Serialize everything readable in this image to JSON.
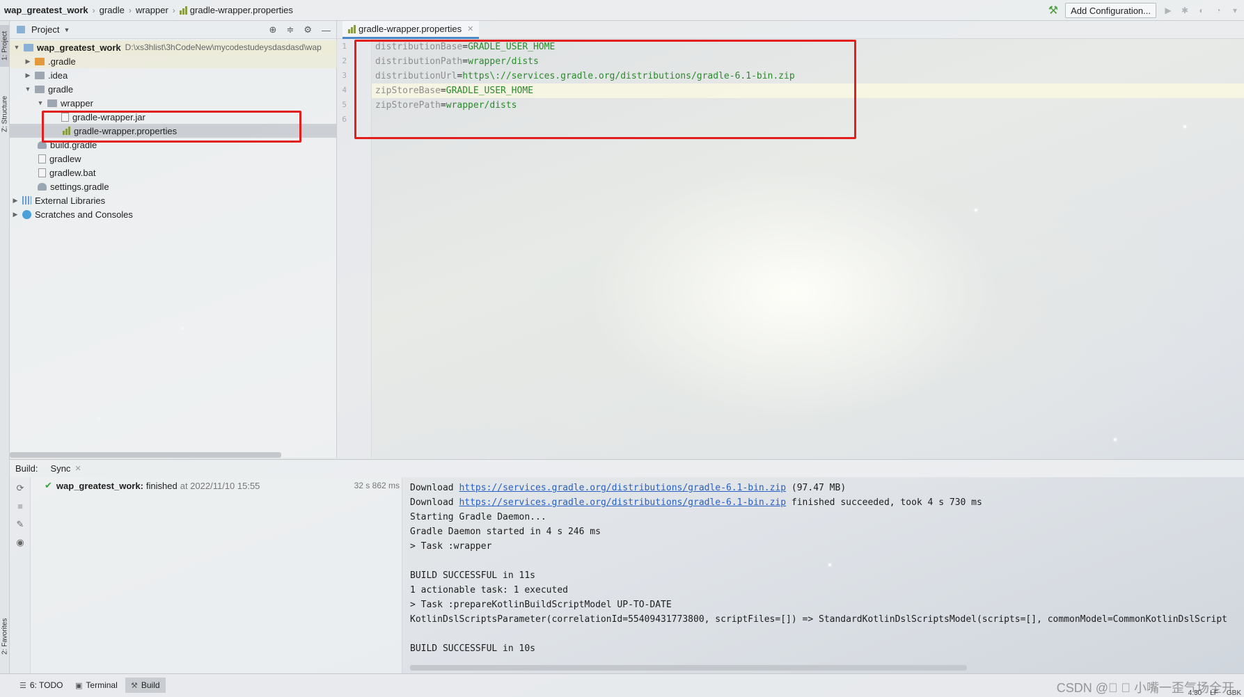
{
  "navbar": {
    "crumbs": [
      "wap_greatest_work",
      "gradle",
      "wrapper",
      "gradle-wrapper.properties"
    ],
    "add_configuration": "Add Configuration..."
  },
  "left_stripe": {
    "project_tab": "1: Project",
    "structure_tab": "Z: Structure",
    "favorites_tab": "2: Favorites"
  },
  "project_panel": {
    "title": "Project",
    "root": {
      "name": "wap_greatest_work",
      "path": "D:\\xs3hlist\\3hCodeNew\\mycodestudeysdasdasd\\wap"
    },
    "items": [
      {
        "label": ".gradle"
      },
      {
        "label": ".idea"
      },
      {
        "label": "gradle"
      },
      {
        "label": "wrapper"
      },
      {
        "label": "gradle-wrapper.jar"
      },
      {
        "label": "gradle-wrapper.properties"
      },
      {
        "label": "build.gradle"
      },
      {
        "label": "gradlew"
      },
      {
        "label": "gradlew.bat"
      },
      {
        "label": "settings.gradle"
      },
      {
        "label": "External Libraries"
      },
      {
        "label": "Scratches and Consoles"
      }
    ]
  },
  "editor": {
    "tab_label": "gradle-wrapper.properties",
    "line_numbers": [
      "1",
      "2",
      "3",
      "4",
      "5",
      "6"
    ],
    "lines": [
      {
        "key": "distributionBase",
        "eq": "=",
        "value": "GRADLE_USER_HOME"
      },
      {
        "key": "distributionPath",
        "eq": "=",
        "value": "wrapper/dists"
      },
      {
        "key": "distributionUrl",
        "eq": "=",
        "value": "https\\://services.gradle.org/distributions/gradle-6.1-bin.zip"
      },
      {
        "key": "zipStoreBase",
        "eq": "=",
        "value": "GRADLE_USER_HOME"
      },
      {
        "key": "zipStorePath",
        "eq": "=",
        "value": "wrapper/dists"
      }
    ]
  },
  "build": {
    "label": "Build:",
    "tab_sync": "Sync",
    "task_name": "wap_greatest_work:",
    "task_status": "finished",
    "task_time": "at 2022/11/10 15:55",
    "task_duration": "32 s 862 ms",
    "console": {
      "line1_prefix": "Download ",
      "line1_link": "https://services.gradle.org/distributions/gradle-6.1-bin.zip",
      "line1_suffix": " (97.47 MB)",
      "line2_prefix": "Download ",
      "line2_link": "https://services.gradle.org/distributions/gradle-6.1-bin.zip",
      "line2_suffix": " finished succeeded, took 4 s 730 ms",
      "line3": "Starting Gradle Daemon...",
      "line4": "Gradle Daemon started in 4 s 246 ms",
      "line5": "> Task :wrapper",
      "line6": "BUILD SUCCESSFUL in 11s",
      "line7": "1 actionable task: 1 executed",
      "line8": "> Task :prepareKotlinBuildScriptModel UP-TO-DATE",
      "line9": "KotlinDslScriptsParameter(correlationId=55409431773800, scriptFiles=[]) => StandardKotlinDslScriptsModel(scripts=[], commonModel=CommonKotlinDslScript",
      "line10": "BUILD SUCCESSFUL in 10s"
    }
  },
  "bottom_bar": {
    "todo": "6: TODO",
    "terminal": "Terminal",
    "build": "Build",
    "watermark": "CSDN @\u0000 \u0000 小嘴一歪气场全开",
    "status_line": "4:30",
    "status_lf": "LF",
    "status_enc": "GBK"
  },
  "colors": {
    "highlight_box": "#e31e1e",
    "property_value": "#2a8a2a",
    "link": "#2760c2"
  }
}
